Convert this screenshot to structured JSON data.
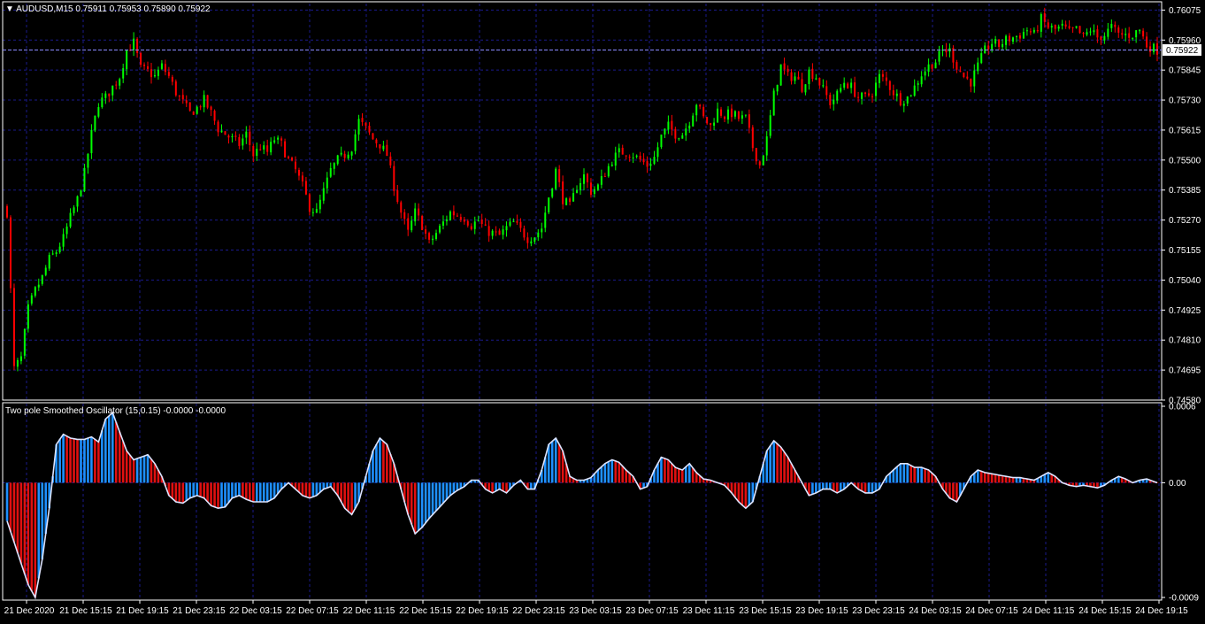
{
  "chart_data": [
    {
      "type": "candlestick",
      "symbol": "AUDUSD,M15",
      "ohlc_header": "0.75911 0.75953 0.75890 0.75922",
      "current_price": "0.75922",
      "ylim": [
        0.7458,
        0.761
      ],
      "y_ticks": [
        "0.76075",
        "0.75960",
        "0.75845",
        "0.75730",
        "0.75615",
        "0.75500",
        "0.75385",
        "0.75270",
        "0.75155",
        "0.75040",
        "0.74925",
        "0.74810",
        "0.74695",
        "0.74580"
      ],
      "x_ticks": [
        "21 Dec 2020",
        "21 Dec 15:15",
        "21 Dec 19:15",
        "21 Dec 23:15",
        "22 Dec 03:15",
        "22 Dec 07:15",
        "22 Dec 11:15",
        "22 Dec 15:15",
        "22 Dec 19:15",
        "22 Dec 23:15",
        "23 Dec 03:15",
        "23 Dec 07:15",
        "23 Dec 11:15",
        "23 Dec 15:15",
        "23 Dec 19:15",
        "23 Dec 23:15",
        "24 Dec 03:15",
        "24 Dec 07:15",
        "24 Dec 11:15",
        "24 Dec 15:15",
        "24 Dec 19:15"
      ],
      "grid": true,
      "bar_count": 328,
      "colors": {
        "up": "#00ff00",
        "down": "#ff0000",
        "grid": "#1a1a8c",
        "axis": "#ffffff"
      },
      "close_path": [
        [
          0,
          0.753
        ],
        [
          2,
          0.747
        ],
        [
          4,
          0.7474
        ],
        [
          6,
          0.7493
        ],
        [
          8,
          0.75
        ],
        [
          10,
          0.7505
        ],
        [
          12,
          0.7512
        ],
        [
          14,
          0.7515
        ],
        [
          16,
          0.752
        ],
        [
          18,
          0.7528
        ],
        [
          20,
          0.7535
        ],
        [
          22,
          0.7545
        ],
        [
          24,
          0.756
        ],
        [
          26,
          0.7572
        ],
        [
          28,
          0.7574
        ],
        [
          30,
          0.7578
        ],
        [
          32,
          0.7582
        ],
        [
          34,
          0.7592
        ],
        [
          36,
          0.7595
        ],
        [
          38,
          0.7585
        ],
        [
          40,
          0.7584
        ],
        [
          42,
          0.7582
        ],
        [
          44,
          0.7586
        ],
        [
          46,
          0.7582
        ],
        [
          48,
          0.7576
        ],
        [
          50,
          0.7572
        ],
        [
          52,
          0.7568
        ],
        [
          54,
          0.757
        ],
        [
          56,
          0.7573
        ],
        [
          58,
          0.7568
        ],
        [
          60,
          0.7562
        ],
        [
          62,
          0.756
        ],
        [
          64,
          0.7558
        ],
        [
          66,
          0.7556
        ],
        [
          68,
          0.756
        ],
        [
          70,
          0.7552
        ],
        [
          72,
          0.7555
        ],
        [
          74,
          0.7553
        ],
        [
          76,
          0.7558
        ],
        [
          78,
          0.7556
        ],
        [
          80,
          0.755
        ],
        [
          82,
          0.7546
        ],
        [
          84,
          0.754
        ],
        [
          86,
          0.7532
        ],
        [
          88,
          0.753
        ],
        [
          90,
          0.7538
        ],
        [
          92,
          0.7546
        ],
        [
          94,
          0.755
        ],
        [
          96,
          0.7552
        ],
        [
          98,
          0.7555
        ],
        [
          100,
          0.7565
        ],
        [
          102,
          0.7562
        ],
        [
          104,
          0.7558
        ],
        [
          106,
          0.7556
        ],
        [
          108,
          0.7552
        ],
        [
          110,
          0.754
        ],
        [
          112,
          0.753
        ],
        [
          114,
          0.7522
        ],
        [
          116,
          0.753
        ],
        [
          118,
          0.7525
        ],
        [
          120,
          0.7518
        ],
        [
          122,
          0.7522
        ],
        [
          124,
          0.7526
        ],
        [
          126,
          0.753
        ],
        [
          128,
          0.7529
        ],
        [
          130,
          0.7528
        ],
        [
          132,
          0.7525
        ],
        [
          134,
          0.7527
        ],
        [
          136,
          0.7523
        ],
        [
          138,
          0.7522
        ],
        [
          140,
          0.7521
        ],
        [
          142,
          0.7524
        ],
        [
          144,
          0.7526
        ],
        [
          146,
          0.7523
        ],
        [
          148,
          0.752
        ],
        [
          150,
          0.7521
        ],
        [
          152,
          0.7524
        ],
        [
          154,
          0.7536
        ],
        [
          156,
          0.7546
        ],
        [
          158,
          0.7535
        ],
        [
          160,
          0.7532
        ],
        [
          162,
          0.754
        ],
        [
          164,
          0.7544
        ],
        [
          166,
          0.7538
        ],
        [
          168,
          0.754
        ],
        [
          170,
          0.7545
        ],
        [
          172,
          0.755
        ],
        [
          174,
          0.7553
        ],
        [
          176,
          0.7553
        ],
        [
          178,
          0.7552
        ],
        [
          180,
          0.755
        ],
        [
          182,
          0.7548
        ],
        [
          184,
          0.7551
        ],
        [
          186,
          0.7559
        ],
        [
          188,
          0.7563
        ],
        [
          190,
          0.756
        ],
        [
          192,
          0.756
        ],
        [
          194,
          0.7565
        ],
        [
          196,
          0.7572
        ],
        [
          198,
          0.7566
        ],
        [
          200,
          0.7563
        ],
        [
          202,
          0.7569
        ],
        [
          204,
          0.7567
        ],
        [
          206,
          0.7568
        ],
        [
          208,
          0.7566
        ],
        [
          210,
          0.7566
        ],
        [
          212,
          0.7555
        ],
        [
          214,
          0.7548
        ],
        [
          216,
          0.7558
        ],
        [
          218,
          0.7575
        ],
        [
          220,
          0.7586
        ],
        [
          222,
          0.7582
        ],
        [
          224,
          0.7582
        ],
        [
          226,
          0.7578
        ],
        [
          228,
          0.7584
        ],
        [
          230,
          0.7582
        ],
        [
          232,
          0.7577
        ],
        [
          234,
          0.7572
        ],
        [
          236,
          0.7575
        ],
        [
          238,
          0.758
        ],
        [
          240,
          0.7578
        ],
        [
          242,
          0.7574
        ],
        [
          244,
          0.7574
        ],
        [
          246,
          0.7576
        ],
        [
          248,
          0.7582
        ],
        [
          250,
          0.758
        ],
        [
          252,
          0.7576
        ],
        [
          254,
          0.7573
        ],
        [
          256,
          0.7574
        ],
        [
          258,
          0.7578
        ],
        [
          260,
          0.7583
        ],
        [
          262,
          0.7586
        ],
        [
          264,
          0.7588
        ],
        [
          266,
          0.7592
        ],
        [
          268,
          0.7592
        ],
        [
          270,
          0.7586
        ],
        [
          272,
          0.7582
        ],
        [
          274,
          0.758
        ],
        [
          276,
          0.7586
        ],
        [
          278,
          0.7592
        ],
        [
          280,
          0.7595
        ],
        [
          282,
          0.7594
        ],
        [
          284,
          0.7596
        ],
        [
          286,
          0.7597
        ],
        [
          288,
          0.7598
        ],
        [
          290,
          0.76
        ],
        [
          292,
          0.7598
        ],
        [
          294,
          0.7604
        ],
        [
          296,
          0.7601
        ],
        [
          298,
          0.76
        ],
        [
          300,
          0.7601
        ],
        [
          302,
          0.7599
        ],
        [
          304,
          0.76
        ],
        [
          306,
          0.7597
        ],
        [
          308,
          0.76
        ],
        [
          310,
          0.7597
        ],
        [
          312,
          0.7598
        ],
        [
          314,
          0.7601
        ],
        [
          316,
          0.7598
        ],
        [
          318,
          0.7598
        ],
        [
          320,
          0.7598
        ],
        [
          322,
          0.76
        ],
        [
          324,
          0.7594
        ],
        [
          327,
          0.75922
        ]
      ]
    },
    {
      "type": "bar",
      "title": "Two pole Smoothed Oscillator (15,0.15) -0.0000 -0.0000",
      "ylim": [
        -0.0009,
        0.0006
      ],
      "y_ticks": [
        "0.0006",
        "0.00",
        "-0.0009"
      ],
      "colors": {
        "rising": "#1e90ff",
        "falling": "#e01010",
        "line": "#dde4ff"
      },
      "line_path": [
        [
          0,
          -0.0003
        ],
        [
          6,
          -0.0008
        ],
        [
          8,
          -0.0009
        ],
        [
          10,
          -0.0006
        ],
        [
          12,
          -0.0002
        ],
        [
          14,
          0.0003
        ],
        [
          16,
          0.00038
        ],
        [
          18,
          0.00035
        ],
        [
          20,
          0.00034
        ],
        [
          22,
          0.00034
        ],
        [
          24,
          0.00036
        ],
        [
          26,
          0.00032
        ],
        [
          28,
          0.0005
        ],
        [
          30,
          0.00055
        ],
        [
          32,
          0.0004
        ],
        [
          34,
          0.00025
        ],
        [
          36,
          0.00018
        ],
        [
          38,
          0.0002
        ],
        [
          40,
          0.00022
        ],
        [
          42,
          0.00015
        ],
        [
          44,
          5e-05
        ],
        [
          46,
          -0.0001
        ],
        [
          48,
          -0.00015
        ],
        [
          50,
          -0.00016
        ],
        [
          52,
          -0.00012
        ],
        [
          54,
          -0.0001
        ],
        [
          56,
          -0.00012
        ],
        [
          58,
          -0.00018
        ],
        [
          60,
          -0.0002
        ],
        [
          62,
          -0.00019
        ],
        [
          64,
          -0.00012
        ],
        [
          66,
          -0.0001
        ],
        [
          68,
          -0.00013
        ],
        [
          70,
          -0.00015
        ],
        [
          74,
          -0.00015
        ],
        [
          76,
          -0.00012
        ],
        [
          78,
          -5e-05
        ],
        [
          80,
          0.0
        ],
        [
          82,
          -5e-05
        ],
        [
          84,
          -0.0001
        ],
        [
          86,
          -0.00012
        ],
        [
          88,
          -0.0001
        ],
        [
          90,
          -5e-05
        ],
        [
          92,
          -3e-05
        ],
        [
          94,
          -0.0001
        ],
        [
          96,
          -0.0002
        ],
        [
          98,
          -0.00025
        ],
        [
          100,
          -0.00015
        ],
        [
          102,
          5e-05
        ],
        [
          104,
          0.00025
        ],
        [
          106,
          0.00035
        ],
        [
          108,
          0.0003
        ],
        [
          110,
          0.00015
        ],
        [
          112,
          -5e-05
        ],
        [
          114,
          -0.00025
        ],
        [
          116,
          -0.0004
        ],
        [
          118,
          -0.00035
        ],
        [
          120,
          -0.00028
        ],
        [
          122,
          -0.00022
        ],
        [
          124,
          -0.00016
        ],
        [
          126,
          -0.0001
        ],
        [
          128,
          -6e-05
        ],
        [
          130,
          -3e-05
        ],
        [
          132,
          2e-05
        ],
        [
          134,
          2e-05
        ],
        [
          136,
          -5e-05
        ],
        [
          138,
          -8e-05
        ],
        [
          140,
          -5e-05
        ],
        [
          142,
          -8e-05
        ],
        [
          144,
          -2e-05
        ],
        [
          146,
          2e-05
        ],
        [
          148,
          -5e-05
        ],
        [
          150,
          -5e-05
        ],
        [
          152,
          0.0001
        ],
        [
          154,
          0.0003
        ],
        [
          156,
          0.00035
        ],
        [
          158,
          0.00025
        ],
        [
          160,
          5e-05
        ],
        [
          162,
          2e-05
        ],
        [
          164,
          2e-05
        ],
        [
          166,
          4e-05
        ],
        [
          168,
          0.0001
        ],
        [
          170,
          0.00015
        ],
        [
          172,
          0.00018
        ],
        [
          174,
          0.00016
        ],
        [
          176,
          0.0001
        ],
        [
          178,
          5e-05
        ],
        [
          180,
          -5e-05
        ],
        [
          182,
          -3e-05
        ],
        [
          184,
          0.0001
        ],
        [
          186,
          0.0002
        ],
        [
          188,
          0.00018
        ],
        [
          190,
          0.00012
        ],
        [
          192,
          0.0001
        ],
        [
          194,
          0.00015
        ],
        [
          196,
          8e-05
        ],
        [
          198,
          3e-05
        ],
        [
          200,
          2e-05
        ],
        [
          202,
          0.0
        ],
        [
          204,
          -2e-05
        ],
        [
          206,
          -8e-05
        ],
        [
          208,
          -0.00015
        ],
        [
          210,
          -0.0002
        ],
        [
          212,
          -0.00015
        ],
        [
          214,
          5e-05
        ],
        [
          216,
          0.00025
        ],
        [
          218,
          0.00033
        ],
        [
          220,
          0.00028
        ],
        [
          222,
          0.0002
        ],
        [
          224,
          0.0001
        ],
        [
          226,
          0.0
        ],
        [
          228,
          -0.0001
        ],
        [
          230,
          -8e-05
        ],
        [
          232,
          -5e-05
        ],
        [
          234,
          -5e-05
        ],
        [
          236,
          -8e-05
        ],
        [
          238,
          -5e-05
        ],
        [
          240,
          0.0
        ],
        [
          242,
          -5e-05
        ],
        [
          244,
          -8e-05
        ],
        [
          246,
          -8e-05
        ],
        [
          248,
          -5e-05
        ],
        [
          250,
          5e-05
        ],
        [
          252,
          0.0001
        ],
        [
          254,
          0.00015
        ],
        [
          256,
          0.00015
        ],
        [
          258,
          0.00012
        ],
        [
          260,
          0.00012
        ],
        [
          262,
          0.0001
        ],
        [
          264,
          5e-05
        ],
        [
          266,
          -5e-05
        ],
        [
          268,
          -0.00012
        ],
        [
          270,
          -0.00015
        ],
        [
          272,
          -5e-05
        ],
        [
          274,
          5e-05
        ],
        [
          276,
          0.0001
        ],
        [
          278,
          8e-05
        ],
        [
          280,
          7e-05
        ],
        [
          282,
          6e-05
        ],
        [
          284,
          5e-05
        ],
        [
          286,
          4e-05
        ],
        [
          288,
          4e-05
        ],
        [
          290,
          3e-05
        ],
        [
          292,
          2e-05
        ],
        [
          294,
          5e-05
        ],
        [
          296,
          8e-05
        ],
        [
          298,
          5e-05
        ],
        [
          300,
          0.0
        ],
        [
          302,
          -2e-05
        ],
        [
          304,
          -3e-05
        ],
        [
          306,
          -2e-05
        ],
        [
          308,
          -3e-05
        ],
        [
          310,
          -4e-05
        ],
        [
          312,
          -2e-05
        ],
        [
          314,
          2e-05
        ],
        [
          316,
          5e-05
        ],
        [
          318,
          3e-05
        ],
        [
          320,
          0.0
        ],
        [
          322,
          2e-05
        ],
        [
          324,
          3e-05
        ],
        [
          327,
          0.0
        ]
      ]
    }
  ]
}
